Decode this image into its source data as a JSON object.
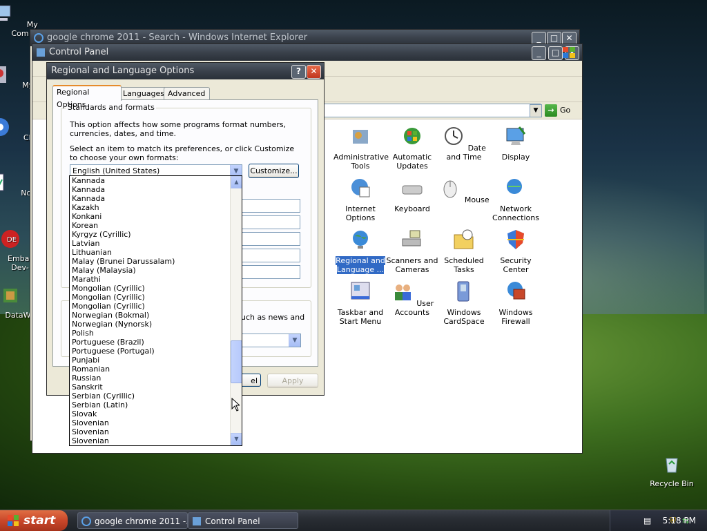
{
  "desktop": {
    "icons": [
      {
        "label": "My Com"
      },
      {
        "label": "MyPa"
      },
      {
        "label": "Chro"
      },
      {
        "label": "Notep"
      },
      {
        "label": "Embar Dev-"
      },
      {
        "label": "DataWa"
      },
      {
        "label": "Recycle Bin"
      }
    ]
  },
  "ie_window": {
    "title": "google chrome 2011 - Search - Windows Internet Explorer"
  },
  "control_panel": {
    "title": "Control Panel",
    "go_label": "Go",
    "items": [
      {
        "label": "Administrative Tools"
      },
      {
        "label": "Automatic Updates"
      },
      {
        "label": "Date and Time"
      },
      {
        "label": "Display"
      },
      {
        "label": "Internet Options"
      },
      {
        "label": "Keyboard"
      },
      {
        "label": "Mouse"
      },
      {
        "label": "Network Connections"
      },
      {
        "label": "Regional and Language ..."
      },
      {
        "label": "Scanners and Cameras"
      },
      {
        "label": "Scheduled Tasks"
      },
      {
        "label": "Security Center"
      },
      {
        "label": "Taskbar and Start Menu"
      },
      {
        "label": "User Accounts"
      },
      {
        "label": "Windows CardSpace"
      },
      {
        "label": "Windows Firewall"
      }
    ]
  },
  "dialog": {
    "title": "Regional and Language Options",
    "tabs": [
      "Regional Options",
      "Languages",
      "Advanced"
    ],
    "group_title": "Standards and formats",
    "desc": "This option affects how some programs format numbers, currencies, dates, and time.",
    "select_prompt": "Select an item to match its preferences, or click Customize to choose your own formats:",
    "selected_format": "English (United States)",
    "customize_label": "Customize...",
    "hidden_text_partial": "uch as news and",
    "cancel_partial": "el",
    "apply_label": "Apply",
    "dropdown_items": [
      "Kannada",
      "Kannada",
      "Kannada",
      "Kazakh",
      "Konkani",
      "Korean",
      "Kyrgyz (Cyrillic)",
      "Latvian",
      "Lithuanian",
      "Malay (Brunei Darussalam)",
      "Malay (Malaysia)",
      "Marathi",
      "Mongolian (Cyrillic)",
      "Mongolian (Cyrillic)",
      "Mongolian (Cyrillic)",
      "Norwegian (Bokmal)",
      "Norwegian (Nynorsk)",
      "Polish",
      "Portuguese (Brazil)",
      "Portuguese (Portugal)",
      "Punjabi",
      "Romanian",
      "Russian",
      "Sanskrit",
      "Serbian (Cyrillic)",
      "Serbian (Latin)",
      "Slovak",
      "Slovenian",
      "Slovenian",
      "Slovenian"
    ]
  },
  "taskbar": {
    "start_label": "start",
    "buttons": [
      {
        "label": "google chrome 2011 -..."
      },
      {
        "label": "Control Panel"
      }
    ],
    "clock": "5:18 PM"
  }
}
